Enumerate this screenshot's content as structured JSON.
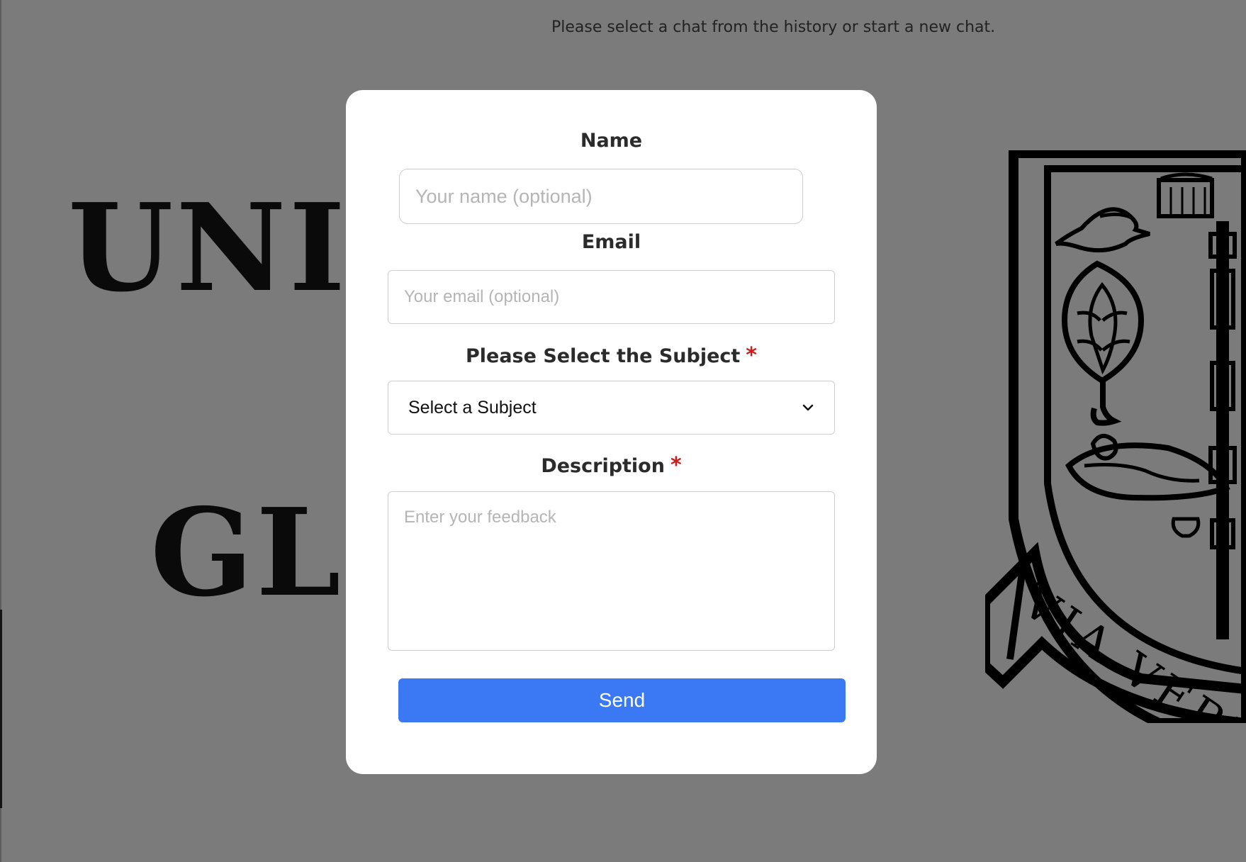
{
  "background": {
    "status_message": "Please select a chat from the history or start a new chat.",
    "logo_text_top": "UNIV",
    "logo_text_bottom": "GL",
    "crest_motto": "VIA VERIT"
  },
  "modal": {
    "name_label": "Name",
    "name_placeholder": "Your name (optional)",
    "email_label": "Email",
    "email_placeholder": "Your email (optional)",
    "subject_label": "Please Select the Subject",
    "subject_required": "*",
    "subject_selected": "Select a Subject",
    "description_label": "Description",
    "description_required": "*",
    "description_placeholder": "Enter your feedback",
    "send_label": "Send"
  },
  "icons": {
    "chevron": "chevron-down-icon",
    "crest": "university-crest-icon"
  },
  "colors": {
    "backdrop": "#7b7b7b",
    "modal": "#ffffff",
    "accent": "#3a79f3",
    "required": "#cc1d1d"
  }
}
